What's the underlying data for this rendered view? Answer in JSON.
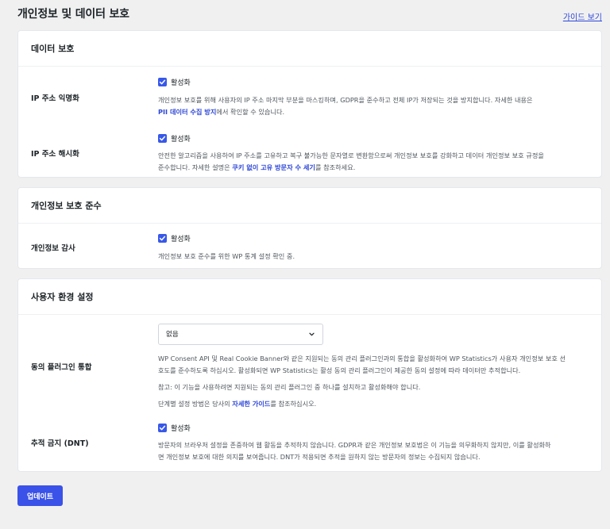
{
  "header": {
    "title": "개인정보 및 데이터 보호",
    "guide_link": "가이드 보기"
  },
  "sections": {
    "data_protection": {
      "title": "데이터 보호",
      "ip_anonymize": {
        "label": "IP 주소 익명화",
        "checkbox_label": "활성화",
        "checked": true,
        "desc_line1": "개인정보 보호를 위해 사용자의 IP 주소 마지막 부분을 마스킹하며, GDPR을 준수하고 전체 IP가 저장되는 것을 방지합니다. 자세한 내용은",
        "desc_link": "PII 데이터 수집 방지",
        "desc_after_link": "에서 확인할 수 있습니다."
      },
      "ip_hash": {
        "label": "IP 주소 해시화",
        "checkbox_label": "활성화",
        "checked": true,
        "desc_line1": "안전한 알고리즘을 사용하여 IP 주소를 고유하고 복구 불가능한 문자열로 변환함으로써 개인정보 보호를 강화하고 데이터 개인정보 보호 규정을",
        "desc_line2_before": "준수합니다. 자세한 설명은",
        "desc_link": "쿠키 없이 고유 방문자 수 세기",
        "desc_after_link": "를 참조하세요."
      }
    },
    "privacy_compliance": {
      "title": "개인정보 보호 준수",
      "audit": {
        "label": "개인정보 감사",
        "checkbox_label": "활성화",
        "checked": true,
        "desc": "개인정보 보호 준수를 위한 WP 통계 설정 확인 중."
      }
    },
    "user_preferences": {
      "title": "사용자 환경 설정",
      "consent": {
        "label": "동의 플러그인 통합",
        "select_value": "없음",
        "desc_line1": "WP Consent API 및 Real Cookie Banner와 같은 지원되는 동의 관리 플러그인과의 통합을 활성화하여 WP Statistics가 사용자 개인정보 보호 선",
        "desc_line2": "호도를 준수하도록 하십시오. 활성화되면 WP Statistics는 활성 동의 관리 플러그인이 제공한 동의 설정에 따라 데이터만 추적합니다.",
        "note": "참고: 이 기능을 사용하려면 지원되는 동의 관리 플러그인 중 하나를 설치하고 활성화해야 합니다.",
        "guide_before": "단계별 설정 방법은 당사의",
        "guide_link": "자세한 가이드",
        "guide_after": "를 참조하십시오."
      },
      "dnt": {
        "label": "추적 금지 (DNT)",
        "checkbox_label": "활성화",
        "checked": true,
        "desc_line1": "방문자의 브라우저 설정을 존중하여 웹 활동을 추적하지 않습니다. GDPR과 같은 개인정보 보호법은 이 기능을 의무화하지 않지만, 이를 활성화하",
        "desc_line2": "면 개인정보 보호에 대한 의지를 보여줍니다. DNT가 적용되면 추적을 원하지 않는 방문자의 정보는 수집되지 않습니다."
      }
    }
  },
  "footer": {
    "update_button": "업데이트"
  },
  "icons": {
    "checkbox": "checkmark-icon",
    "select": "chevron-down-icon"
  },
  "colors": {
    "accent": "#3858e9",
    "link": "#2d46d6",
    "background": "#f0f0f1"
  }
}
